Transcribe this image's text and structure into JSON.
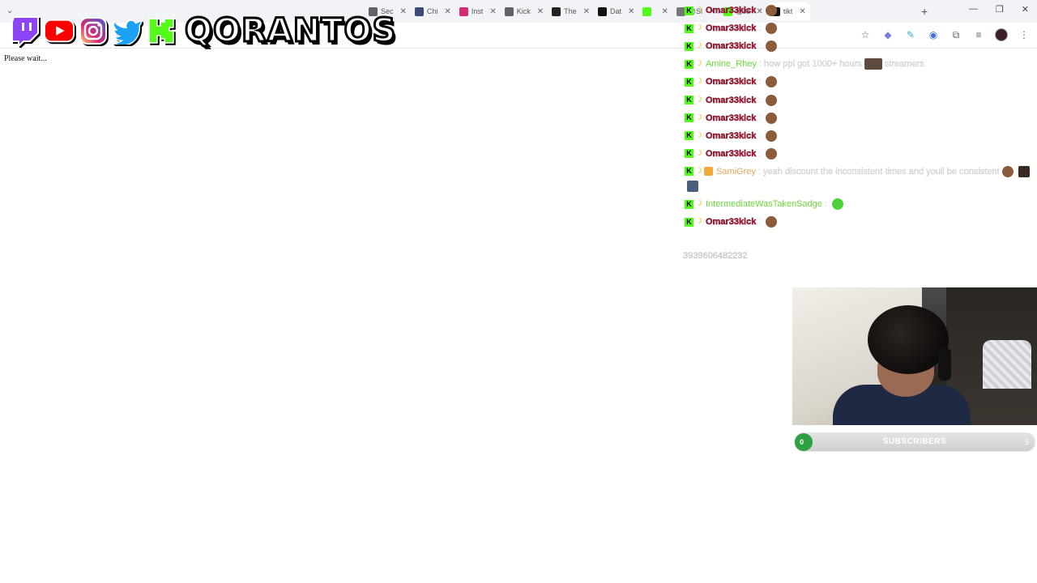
{
  "browser": {
    "tabs": [
      {
        "title": "Sec",
        "favicon_color": "#5f6368",
        "active": false
      },
      {
        "title": "Chi",
        "favicon_color": "#3c4a7a",
        "active": false
      },
      {
        "title": "Inst",
        "favicon_color": "#d62976",
        "active": false
      },
      {
        "title": "Kick",
        "favicon_color": "#5f6368",
        "active": false
      },
      {
        "title": "The",
        "favicon_color": "#222222",
        "active": false
      },
      {
        "title": "Dat",
        "favicon_color": "#111111",
        "active": false
      },
      {
        "title": "",
        "favicon_color": "#53fc18",
        "active": false
      },
      {
        "title": "@Sl",
        "favicon_color": "#777777",
        "active": false
      },
      {
        "title": "@Ki",
        "favicon_color": "#53fc18",
        "active": false
      },
      {
        "title": "tikt",
        "favicon_color": "#111111",
        "active": true
      }
    ],
    "new_tab": "+",
    "window_controls": [
      "—",
      "❐",
      "✕"
    ]
  },
  "page": {
    "status_text": "Please wait..."
  },
  "overlay": {
    "streamer_name": "QORANTOS",
    "social_icons": [
      "twitch-icon",
      "youtube-icon",
      "instagram-icon",
      "twitter-icon",
      "kick-icon"
    ],
    "chat": [
      {
        "user": "Omar33kick",
        "color": "red",
        "text": "",
        "emotes": [
          "head"
        ],
        "badges": [
          "k",
          "banana"
        ]
      },
      {
        "user": "Omar33kick",
        "color": "red",
        "text": "",
        "emotes": [
          "head"
        ],
        "badges": [
          "k",
          "banana"
        ]
      },
      {
        "user": "Omar33kick",
        "color": "red",
        "text": "",
        "emotes": [
          "head"
        ],
        "badges": [
          "k",
          "banana"
        ]
      },
      {
        "user": "Amine_Rhey",
        "color": "green",
        "text": "how ppl got 1000+ hours",
        "text2": "streamers",
        "emotes": [
          "cat"
        ],
        "badges": [
          "k",
          "banana"
        ]
      },
      {
        "user": "Omar33kick",
        "color": "red",
        "text": "",
        "emotes": [
          "head"
        ],
        "badges": [
          "k",
          "banana"
        ]
      },
      {
        "user": "Omar33kick",
        "color": "red",
        "text": "",
        "emotes": [
          "head"
        ],
        "badges": [
          "k",
          "banana"
        ]
      },
      {
        "user": "Omar33kick",
        "color": "red",
        "text": "",
        "emotes": [
          "head"
        ],
        "badges": [
          "k",
          "banana"
        ]
      },
      {
        "user": "Omar33kick",
        "color": "red",
        "text": "",
        "emotes": [
          "head"
        ],
        "badges": [
          "k",
          "banana"
        ]
      },
      {
        "user": "Omar33kick",
        "color": "red",
        "text": "",
        "emotes": [
          "head"
        ],
        "badges": [
          "k",
          "banana"
        ]
      },
      {
        "user": "SamiGrey",
        "color": "gold",
        "text": "yeah discount the inconsistent times and youll be consistent",
        "emotes": [
          "head",
          "dark",
          "bluegray"
        ],
        "badges": [
          "k",
          "banana",
          "gift"
        ]
      },
      {
        "user": "IntermediateWasTakenSadge",
        "color": "green",
        "text": "",
        "emotes": [
          "greenblob"
        ],
        "badges": [
          "k",
          "banana"
        ]
      },
      {
        "user": "Omar33kick",
        "color": "red",
        "text": "",
        "emotes": [
          "head"
        ],
        "badges": [
          "k",
          "banana"
        ]
      }
    ],
    "chat_id": "3939606482232"
  },
  "subgoal": {
    "label": "SUBSCRIBERS",
    "current": "0",
    "target": "5",
    "progress_fraction": 0.0
  },
  "colors": {
    "kick_green": "#53fc18",
    "goal_fill": "#2da043",
    "username_red": "#b51838"
  }
}
